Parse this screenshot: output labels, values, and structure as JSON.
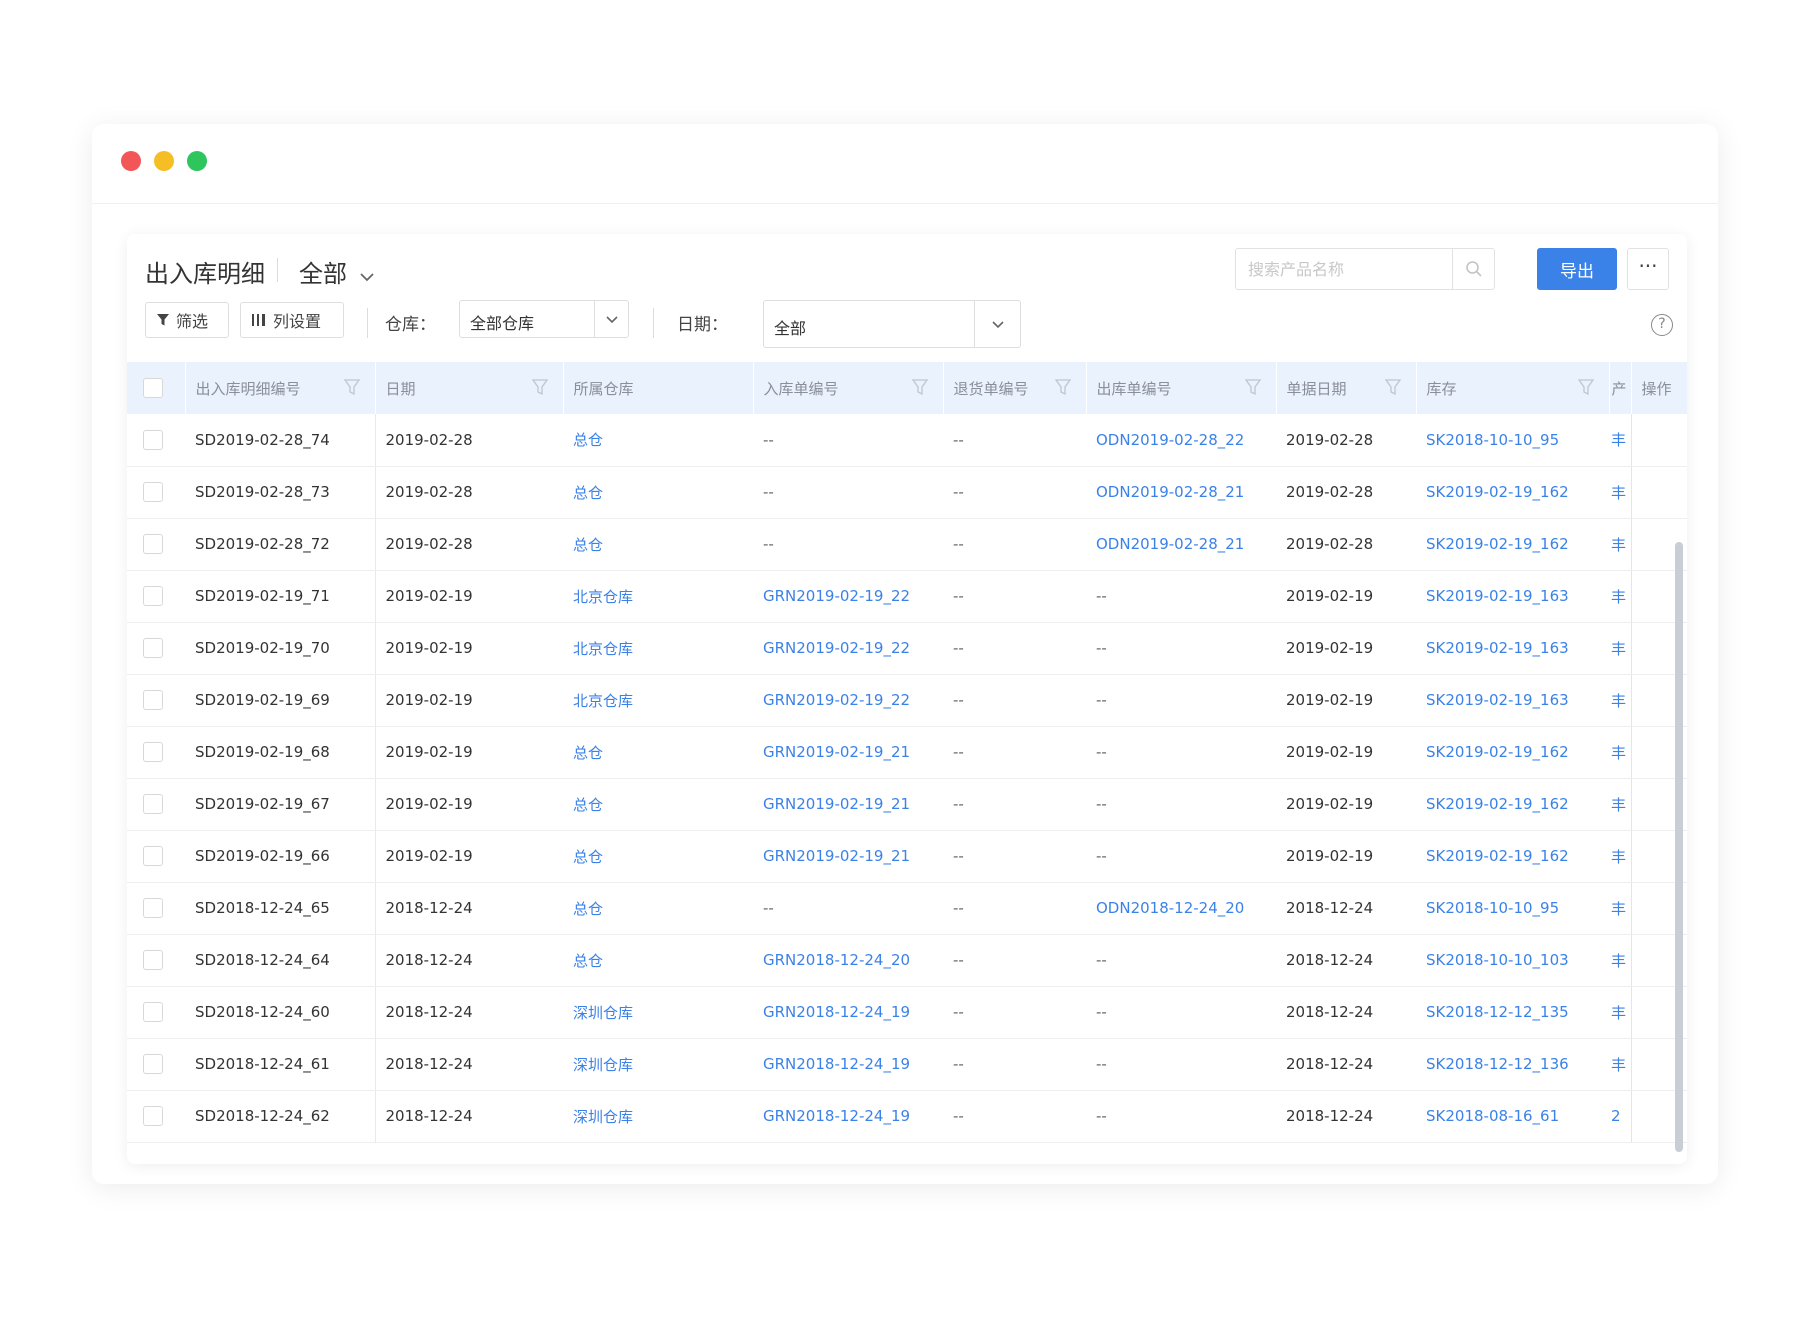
{
  "header": {
    "title": "出入库明细",
    "scope": "全部",
    "search_placeholder": "搜索产品名称",
    "export_label": "导出",
    "more_label": "···"
  },
  "filters": {
    "filter_btn": "筛选",
    "columns_btn": "列设置",
    "warehouse_label": "仓库：",
    "warehouse_value": "全部仓库",
    "date_label": "日期：",
    "date_value": "全部",
    "help": "?"
  },
  "table": {
    "columns": [
      "出入库明细编号",
      "日期",
      "所属仓库",
      "入库单编号",
      "退货单编号",
      "出库单编号",
      "单据日期",
      "库存",
      "产",
      "操作"
    ],
    "rows": [
      {
        "id": "SD2019-02-28_74",
        "date": "2019-02-28",
        "warehouse": "总仓",
        "inbound": "--",
        "returns": "--",
        "outbound": "ODN2019-02-28_22",
        "doc_date": "2019-02-28",
        "stock": "SK2018-10-10_95",
        "prod": "丰"
      },
      {
        "id": "SD2019-02-28_73",
        "date": "2019-02-28",
        "warehouse": "总仓",
        "inbound": "--",
        "returns": "--",
        "outbound": "ODN2019-02-28_21",
        "doc_date": "2019-02-28",
        "stock": "SK2019-02-19_162",
        "prod": "丰"
      },
      {
        "id": "SD2019-02-28_72",
        "date": "2019-02-28",
        "warehouse": "总仓",
        "inbound": "--",
        "returns": "--",
        "outbound": "ODN2019-02-28_21",
        "doc_date": "2019-02-28",
        "stock": "SK2019-02-19_162",
        "prod": "丰"
      },
      {
        "id": "SD2019-02-19_71",
        "date": "2019-02-19",
        "warehouse": "北京仓库",
        "inbound": "GRN2019-02-19_22",
        "returns": "--",
        "outbound": "--",
        "doc_date": "2019-02-19",
        "stock": "SK2019-02-19_163",
        "prod": "丰"
      },
      {
        "id": "SD2019-02-19_70",
        "date": "2019-02-19",
        "warehouse": "北京仓库",
        "inbound": "GRN2019-02-19_22",
        "returns": "--",
        "outbound": "--",
        "doc_date": "2019-02-19",
        "stock": "SK2019-02-19_163",
        "prod": "丰"
      },
      {
        "id": "SD2019-02-19_69",
        "date": "2019-02-19",
        "warehouse": "北京仓库",
        "inbound": "GRN2019-02-19_22",
        "returns": "--",
        "outbound": "--",
        "doc_date": "2019-02-19",
        "stock": "SK2019-02-19_163",
        "prod": "丰"
      },
      {
        "id": "SD2019-02-19_68",
        "date": "2019-02-19",
        "warehouse": "总仓",
        "inbound": "GRN2019-02-19_21",
        "returns": "--",
        "outbound": "--",
        "doc_date": "2019-02-19",
        "stock": "SK2019-02-19_162",
        "prod": "丰"
      },
      {
        "id": "SD2019-02-19_67",
        "date": "2019-02-19",
        "warehouse": "总仓",
        "inbound": "GRN2019-02-19_21",
        "returns": "--",
        "outbound": "--",
        "doc_date": "2019-02-19",
        "stock": "SK2019-02-19_162",
        "prod": "丰"
      },
      {
        "id": "SD2019-02-19_66",
        "date": "2019-02-19",
        "warehouse": "总仓",
        "inbound": "GRN2019-02-19_21",
        "returns": "--",
        "outbound": "--",
        "doc_date": "2019-02-19",
        "stock": "SK2019-02-19_162",
        "prod": "丰"
      },
      {
        "id": "SD2018-12-24_65",
        "date": "2018-12-24",
        "warehouse": "总仓",
        "inbound": "--",
        "returns": "--",
        "outbound": "ODN2018-12-24_20",
        "doc_date": "2018-12-24",
        "stock": "SK2018-10-10_95",
        "prod": "丰"
      },
      {
        "id": "SD2018-12-24_64",
        "date": "2018-12-24",
        "warehouse": "总仓",
        "inbound": "GRN2018-12-24_20",
        "returns": "--",
        "outbound": "--",
        "doc_date": "2018-12-24",
        "stock": "SK2018-10-10_103",
        "prod": "丰"
      },
      {
        "id": "SD2018-12-24_60",
        "date": "2018-12-24",
        "warehouse": "深圳仓库",
        "inbound": "GRN2018-12-24_19",
        "returns": "--",
        "outbound": "--",
        "doc_date": "2018-12-24",
        "stock": "SK2018-12-12_135",
        "prod": "丰"
      },
      {
        "id": "SD2018-12-24_61",
        "date": "2018-12-24",
        "warehouse": "深圳仓库",
        "inbound": "GRN2018-12-24_19",
        "returns": "--",
        "outbound": "--",
        "doc_date": "2018-12-24",
        "stock": "SK2018-12-12_136",
        "prod": "丰"
      },
      {
        "id": "SD2018-12-24_62",
        "date": "2018-12-24",
        "warehouse": "深圳仓库",
        "inbound": "GRN2018-12-24_19",
        "returns": "--",
        "outbound": "--",
        "doc_date": "2018-12-24",
        "stock": "SK2018-08-16_61",
        "prod": "2"
      }
    ]
  },
  "colors": {
    "accent": "#3b82e8",
    "header_bg": "#eaf2fd"
  }
}
